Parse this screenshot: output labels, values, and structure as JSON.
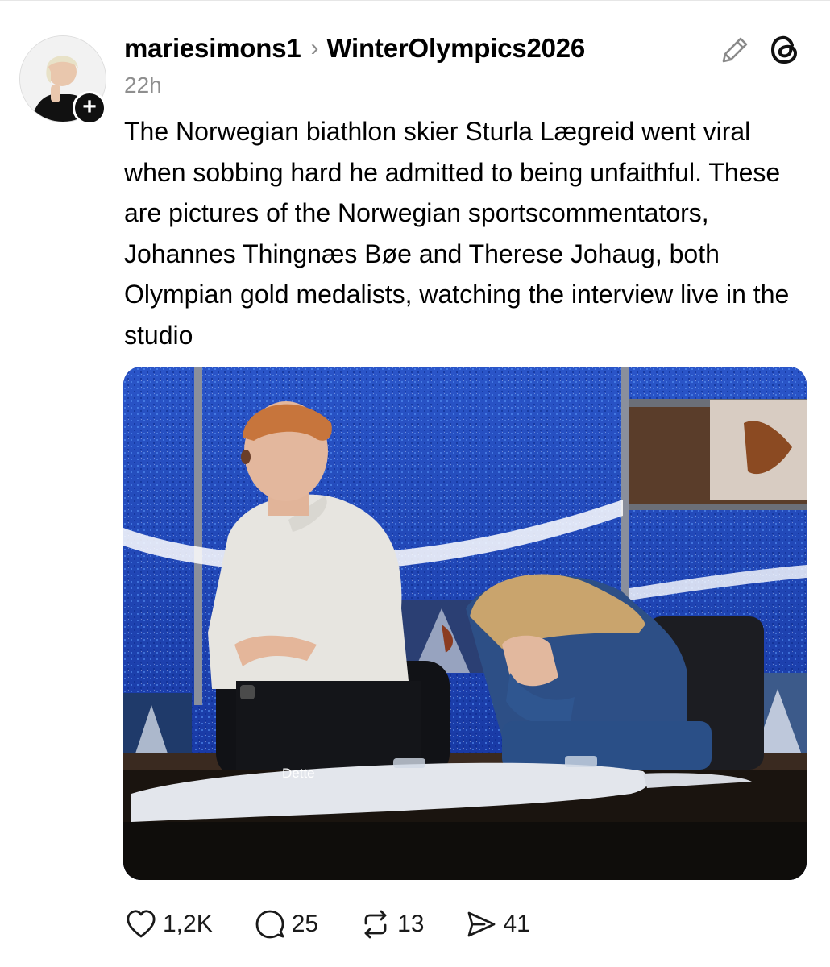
{
  "post": {
    "username": "mariesimons1",
    "breadcrumb_separator": "›",
    "community": "WinterOlympics2026",
    "time_ago": "22h",
    "body": "The Norwegian biathlon skier Sturla Lægreid went viral when sobbing hard he admitted to being unfaithful. These are pictures of the Norwegian sportscommentators, Johannes Thingnæs Bøe and Therese Johaug, both Olympian gold medalists, watching the interview live in the studio",
    "follow_symbol": "+"
  },
  "media": {
    "caption_text": "Dette"
  },
  "icons": {
    "edit": "pencil-icon",
    "app": "threads-logo-icon",
    "like": "heart-icon",
    "reply": "comment-icon",
    "repost": "repost-icon",
    "share": "send-icon"
  },
  "stats": {
    "likes": "1,2K",
    "replies": "25",
    "reposts": "13",
    "shares": "41"
  }
}
